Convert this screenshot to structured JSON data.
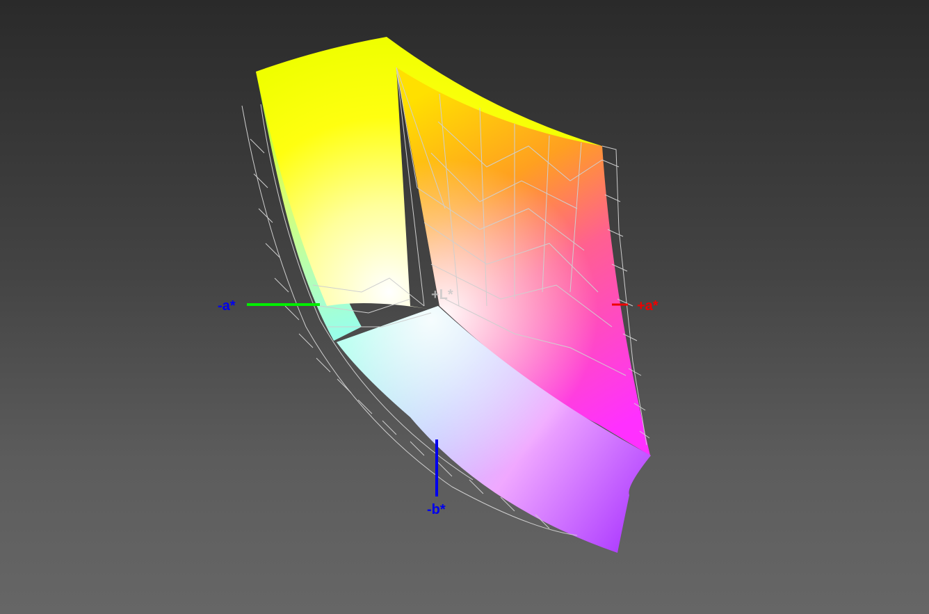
{
  "axes": {
    "neg_a": {
      "label": "-a*",
      "color": "#0000ee"
    },
    "pos_a": {
      "label": "+a*",
      "color": "#ee0000"
    },
    "neg_b": {
      "label": "-b*",
      "color": "#0000ee"
    },
    "pos_l": {
      "label": "+L*",
      "color": "#c8c8c8"
    }
  },
  "colors": {
    "green_axis": "#00ee00",
    "red_axis": "#ee0000",
    "blue_axis": "#0000ee",
    "wireframe": "#cfcfcf"
  }
}
